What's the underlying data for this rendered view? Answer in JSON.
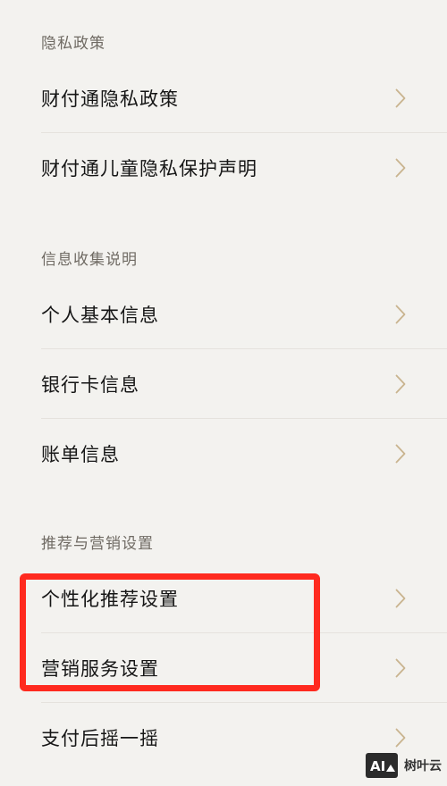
{
  "sections": [
    {
      "header": "隐私政策",
      "items": [
        {
          "label": "财付通隐私政策"
        },
        {
          "label": "财付通儿童隐私保护声明"
        }
      ]
    },
    {
      "header": "信息收集说明",
      "items": [
        {
          "label": "个人基本信息"
        },
        {
          "label": "银行卡信息"
        },
        {
          "label": "账单信息"
        }
      ]
    },
    {
      "header": "推荐与营销设置",
      "items": [
        {
          "label": "个性化推荐设置"
        },
        {
          "label": "营销服务设置"
        },
        {
          "label": "支付后摇一摇"
        }
      ]
    }
  ],
  "watermark": {
    "logo_text": "AI",
    "label": "树叶云"
  },
  "colors": {
    "background": "#f3f2ef",
    "chevron": "#c9b48f",
    "highlight": "#ff2a1f"
  }
}
